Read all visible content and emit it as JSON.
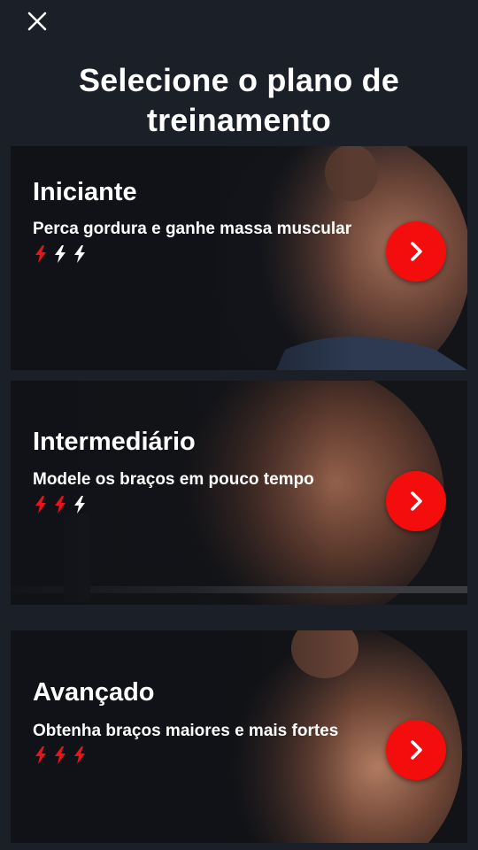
{
  "header": {
    "close_icon": "close-icon",
    "title": "Selecione o plano de treinamento"
  },
  "plans": [
    {
      "title": "Iniciante",
      "subtitle": "Perca gordura e ganhe massa muscular",
      "intensity": 1,
      "intensity_max": 3
    },
    {
      "title": "Intermediário",
      "subtitle": "Modele os braços em pouco tempo",
      "intensity": 2,
      "intensity_max": 3
    },
    {
      "title": "Avançado",
      "subtitle": "Obtenha braços maiores e mais fortes",
      "intensity": 3,
      "intensity_max": 3
    }
  ],
  "colors": {
    "background": "#1b1f27",
    "accent": "#f40d0d",
    "bolt_active": "#e8141a",
    "bolt_inactive": "#ffffff",
    "text": "#ffffff"
  }
}
